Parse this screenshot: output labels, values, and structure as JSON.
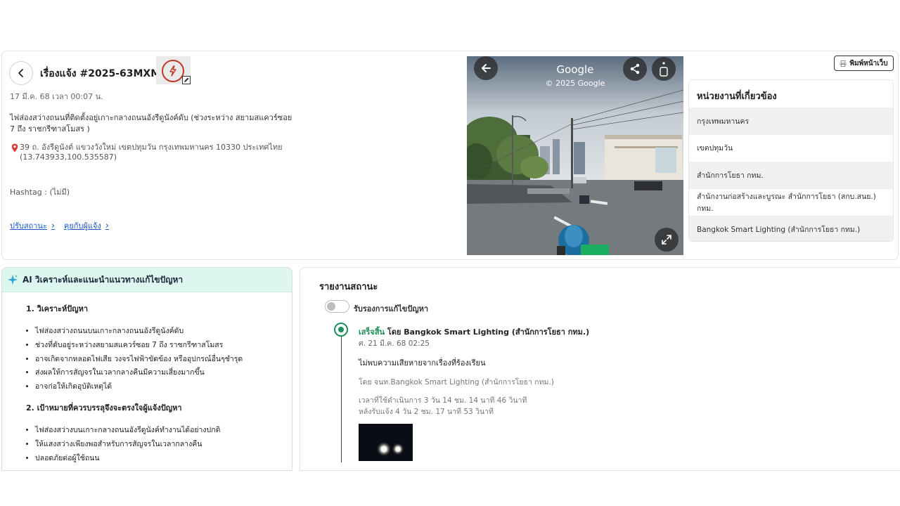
{
  "issue": {
    "title": "เรื่องแจ้ง #2025-63MXMA",
    "datetime": "17 มี.ค. 68 เวลา 00:07 น.",
    "description": "ไฟส่องสว่างถนนที่ติดตั้งอยู่เกาะกลางถนนอังรีดูนังค์ดับ (ช่วงระหว่าง สยามสแควร์ซอย 7 ถึง ราชกรีฑาสโมสร )",
    "address": "39 ถ. อังรีดูนังต์ แขวงวังใหม่ เขตปทุมวัน กรุงเทพมหานคร 10330 ประเทศไทย (13.743933,100.535587)",
    "hashtag": "Hashtag :  (ไม่มี)",
    "links": {
      "update_status": "ปรับสถานะ",
      "chat_reporter": "คุยกับผู้แจ้ง"
    },
    "type_icon": "lightning-icon",
    "accent_color": "#c0392b"
  },
  "streetview": {
    "provider": "Google",
    "copyright": "© 2025 Google"
  },
  "print_button": "พิมพ์หน้าเว็บ",
  "agencies": {
    "title": "หน่วยงานที่เกี่ยวข้อง",
    "items": [
      "กรุงเทพมหานคร",
      "เขตปทุมวัน",
      "สำนักการโยธา กทม.",
      "สำนักงานก่อสร้างและบูรณะ สำนักการโยธา (สกบ.สนย.) กทม.",
      "Bangkok Smart Lighting (สำนักการโยธา กทม.)"
    ]
  },
  "ai": {
    "title": "AI วิเคราะห์และแนะนำแนวทางแก้ไขปัญหา",
    "sections": [
      {
        "heading": "วิเคราะห์ปัญหา",
        "bullets": [
          "ไฟส่องสว่างถนนบนเกาะกลางถนนอังรีดูนังค์ดับ",
          "ช่วงที่ดับอยู่ระหว่างสยามสแควร์ซอย 7 ถึง ราชกรีฑาสโมสร",
          "อาจเกิดจากหลอดไฟเสีย วงจรไฟฟ้าขัดข้อง หรืออุปกรณ์อื่นๆชำรุด",
          "ส่งผลให้การสัญจรในเวลากลางคืนมีความเสี่ยงมากขึ้น",
          "อาจก่อให้เกิดอุบัติเหตุได้"
        ]
      },
      {
        "heading": "เป้าหมายที่ควรบรรลุจึงจะตรงใจผู้แจ้งปัญหา",
        "bullets": [
          "ไฟส่องสว่างบนเกาะกลางถนนอังรีดูนังค์ทำงานได้อย่างปกติ",
          "ให้แสงสว่างเพียงพอสำหรับการสัญจรในเวลากลางคืน",
          "ปลอดภัยต่อผู้ใช้ถนน"
        ]
      }
    ]
  },
  "status": {
    "title": "รายงานสถานะ",
    "toggle_label": "รับรองการแก้ไขปัญหา",
    "toggle_on": false,
    "entry": {
      "status": "เสร็จสิ้น",
      "by_label": "โดย Bangkok Smart Lighting (สำนักการโยธา กทม.)",
      "date": "ศ. 21 มี.ค. 68 02:25",
      "message": "ไม่พบความเสียหายจากเรื่องที่ร้องเรียน",
      "officer": "โดย จนท.Bangkok Smart Lighting (สำนักการโยธา กทม.)",
      "duration_1": "เวลาที่ใช้ดำเนินการ 3 วัน 14 ชม. 14 นาที 46 วินาที",
      "duration_2": "หลังรับแจ้ง 4 วัน 2 ชม. 17 นาที 53 วินาที"
    },
    "status_color": "#1e8e5a"
  }
}
